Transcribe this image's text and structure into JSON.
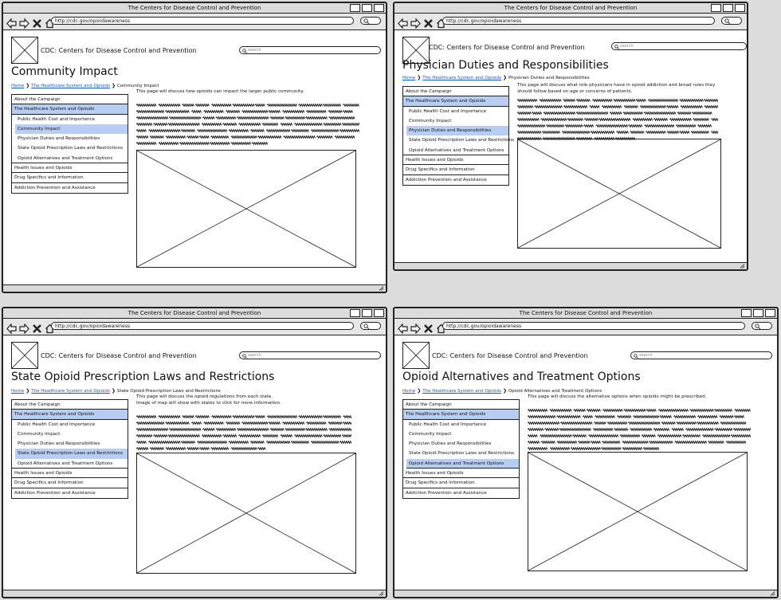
{
  "window_title": "The Centers for Disease Control and Prevention",
  "url": "http://cdc.gov/opioidawareness",
  "site_title": "CDC: Centers for Disease Control and Prevention",
  "search_placeholder": "search",
  "sidebar": {
    "about": "About the Campaign",
    "healthcare": "The Healthcare System and Opioids",
    "sub1": "Public Health Cost and Importance",
    "sub2": "Community Impact",
    "sub3": "Physician Duties and Responsibilities",
    "sub4": "State Opioid Prescription Laws and Restrictions",
    "sub5": "Opioid Alternatives and Treatment Options",
    "health_issues": "Health Issues and Opioids",
    "drug_specifics": "Drug Specifics and Information",
    "addiction": "Addiction Prevention and Assistance"
  },
  "breadcrumb": {
    "home": "Home",
    "parent": "The Healthcare System and Opioids"
  },
  "pages": [
    {
      "title": "Community Impact",
      "crumb_current": "Community Impact",
      "description": "This page will discuss how opioids can impact the larger public community.",
      "selected": "sub2"
    },
    {
      "title": "Physician Duties and Responsibilities",
      "crumb_current": "Physician Duties and Responsibilities",
      "description": "This page will discuss what role physicians have in opioid addiction and broad rules they should follow based on age or concerns of patients.",
      "selected": "sub3"
    },
    {
      "title": "State Opioid Prescription Laws and Restrictions",
      "crumb_current": "State Opioid Prescription Laws and Restrictions",
      "description": "This page will discuss the opioid regulations from each state.",
      "description2": "Image of map will show with states to click for more information.",
      "selected": "sub4"
    },
    {
      "title": "Opioid Alternatives and Treatment Options",
      "crumb_current": "Opioid Alternatives and Treatment Options",
      "description": "This page will discuss the alternative options when opioids might be prescribed.",
      "selected": "sub5"
    }
  ],
  "colors": {
    "selection": "#b8cdf2",
    "link": "#1f55c8",
    "chrome": "#dcdcdc"
  }
}
